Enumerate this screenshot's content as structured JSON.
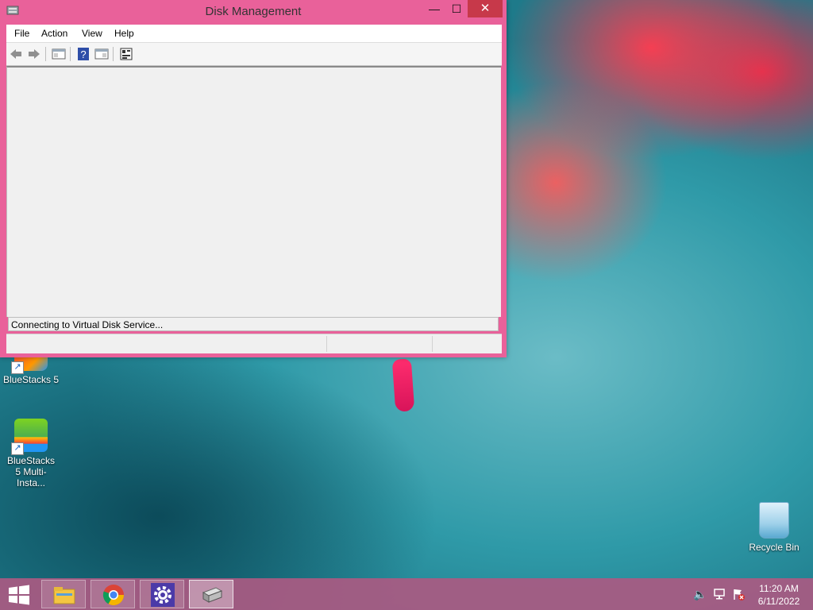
{
  "window": {
    "title": "Disk Management",
    "menu": [
      "File",
      "Action",
      "View",
      "Help"
    ],
    "status_text": "Connecting to Virtual Disk Service...",
    "controls": {
      "minimize": "—",
      "maximize": "☐",
      "close": "✕"
    }
  },
  "toolbar": {
    "buttons": [
      "back-arrow-icon",
      "forward-arrow-icon",
      "show-hide-console-tree-icon",
      "help-icon",
      "show-action-pane-icon",
      "properties-icon"
    ]
  },
  "desktop": {
    "icons": [
      {
        "label": "BlueStacks 5"
      },
      {
        "label": "BlueStacks 5 Multi-Insta..."
      },
      {
        "label": "Recycle Bin"
      }
    ]
  },
  "taskbar": {
    "apps": [
      "file-explorer-icon",
      "chrome-icon",
      "settings-icon",
      "disk-management-icon"
    ],
    "time": "11:20 AM",
    "date": "6/11/2022"
  },
  "colors": {
    "window_frame": "#e9619a",
    "close_button": "#c7394a",
    "taskbar": "#aa5a82"
  }
}
